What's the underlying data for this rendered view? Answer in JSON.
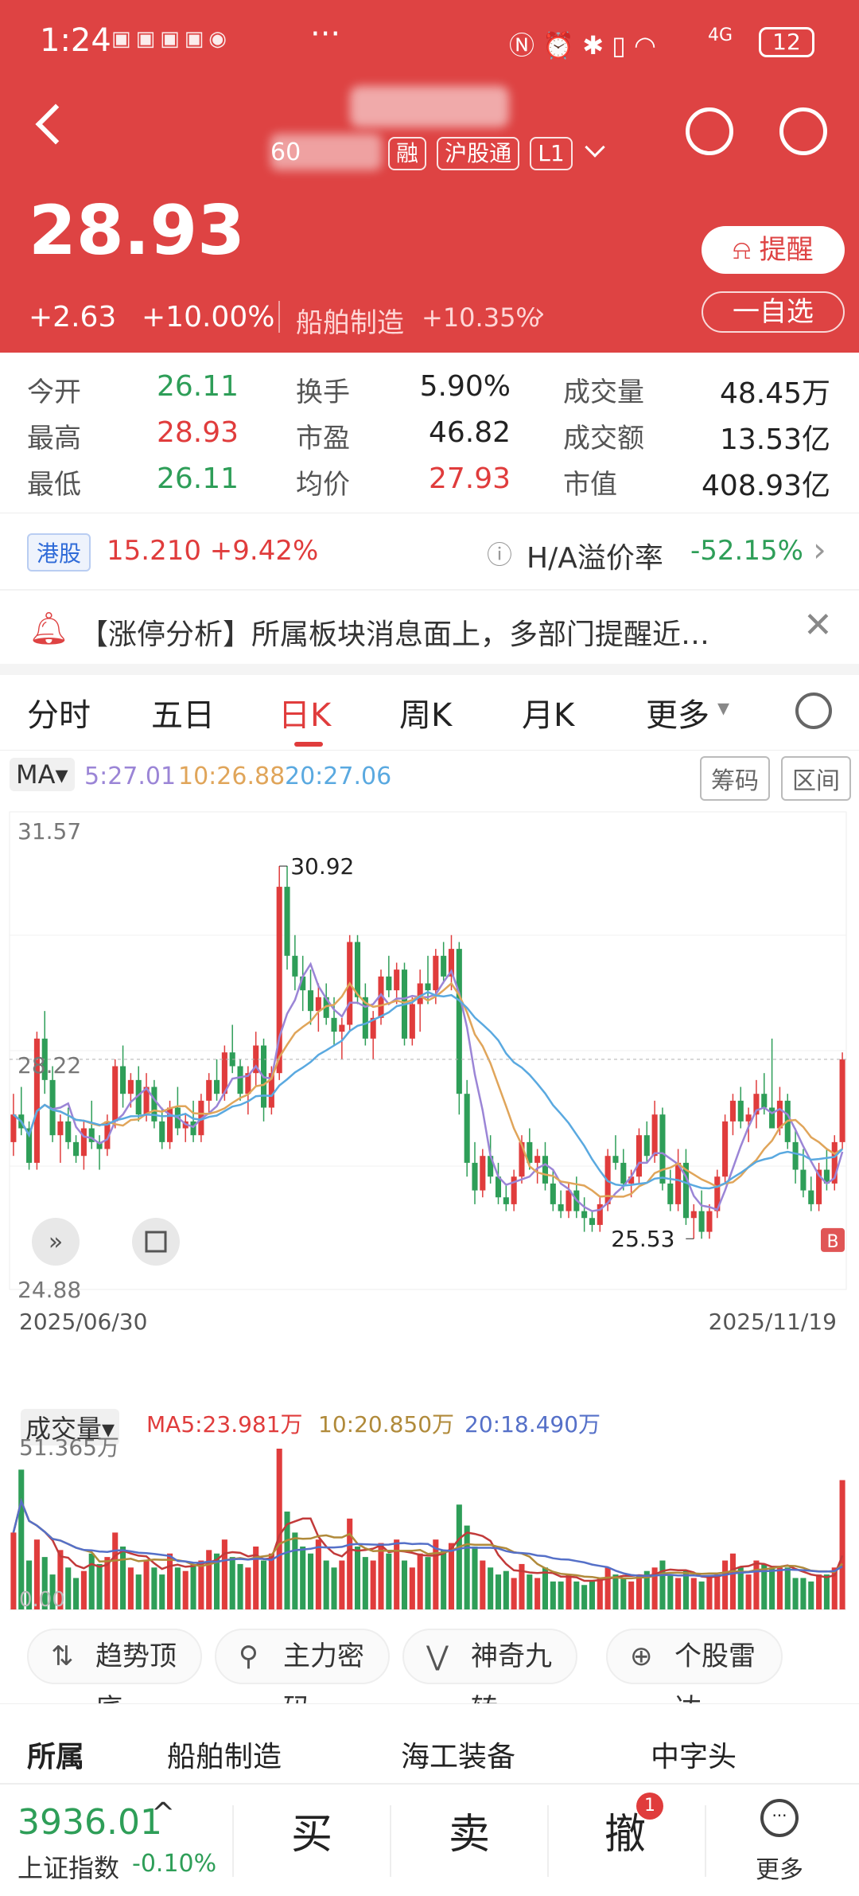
{
  "status": {
    "time": "1:24",
    "dots": "···",
    "network": "4G",
    "battery": "12"
  },
  "header": {
    "ticker_masked": "60",
    "tag_hk": "沪股通",
    "tag_level": "L1",
    "price": "28.93",
    "change": "+2.63",
    "change_pct": "+10.00%",
    "sector": "船舶制造",
    "sector_pct": "+10.35%",
    "remind": "提醒",
    "watch": "一自选"
  },
  "stats": [
    {
      "label": "今开",
      "value": "26.11",
      "tone": "green"
    },
    {
      "label": "换手",
      "value": "5.90%",
      "tone": "neutral"
    },
    {
      "label": "成交量",
      "value": "48.45万",
      "tone": "neutral"
    },
    {
      "label": "最高",
      "value": "28.93",
      "tone": "red"
    },
    {
      "label": "市盈",
      "value": "46.82",
      "tone": "neutral"
    },
    {
      "label": "成交额",
      "value": "13.53亿",
      "tone": "neutral"
    },
    {
      "label": "最低",
      "value": "26.11",
      "tone": "green"
    },
    {
      "label": "均价",
      "value": "27.93",
      "tone": "red"
    },
    {
      "label": "市值",
      "value": "408.93亿",
      "tone": "neutral"
    }
  ],
  "hk": {
    "badge": "港股",
    "quote": "15.210 +9.42%",
    "premium_label": "H/A溢价率",
    "premium_value": "-52.15%"
  },
  "news": {
    "text": "【涨停分析】所属板块消息面上，多部门提醒近…"
  },
  "tabs": [
    "分时",
    "五日",
    "日K",
    "周K",
    "月K",
    "更多"
  ],
  "ma": {
    "label": "MA",
    "ma5": "5:27.01",
    "ma10": "10:26.88",
    "ma20": "20:27.06",
    "chip1": "筹码",
    "chip2": "区间"
  },
  "chart_data": {
    "type": "candlestick",
    "ylim": [
      24.88,
      31.57
    ],
    "y_ticks": [
      "31.57",
      "28.22",
      "24.88"
    ],
    "start_date": "2025/06/30",
    "end_date": "2025/11/19",
    "annotations": {
      "high": "30.92",
      "low": "25.53"
    },
    "candles": [
      [
        26.9,
        27.6,
        26.7,
        27.3
      ],
      [
        27.3,
        27.7,
        27.0,
        27.1
      ],
      [
        27.1,
        27.2,
        26.5,
        26.6
      ],
      [
        26.6,
        28.5,
        26.5,
        28.4
      ],
      [
        28.4,
        28.8,
        27.6,
        27.8
      ],
      [
        27.8,
        28.0,
        26.9,
        27.0
      ],
      [
        27.0,
        27.3,
        26.6,
        27.2
      ],
      [
        27.2,
        27.4,
        26.8,
        26.9
      ],
      [
        26.9,
        27.0,
        26.6,
        26.7
      ],
      [
        26.7,
        27.2,
        26.5,
        27.1
      ],
      [
        27.1,
        27.5,
        26.8,
        26.9
      ],
      [
        26.9,
        27.0,
        26.5,
        26.8
      ],
      [
        26.8,
        27.3,
        26.7,
        27.2
      ],
      [
        27.2,
        28.1,
        27.1,
        28.0
      ],
      [
        28.0,
        28.3,
        27.4,
        27.6
      ],
      [
        27.6,
        27.9,
        27.4,
        27.8
      ],
      [
        27.8,
        28.0,
        27.2,
        27.3
      ],
      [
        27.3,
        27.9,
        27.2,
        27.7
      ],
      [
        27.7,
        27.8,
        27.1,
        27.2
      ],
      [
        27.2,
        27.4,
        26.8,
        26.9
      ],
      [
        26.9,
        27.5,
        26.8,
        27.4
      ],
      [
        27.4,
        27.7,
        27.0,
        27.1
      ],
      [
        27.1,
        27.3,
        26.9,
        27.2
      ],
      [
        27.2,
        27.5,
        26.9,
        27.0
      ],
      [
        27.0,
        27.6,
        26.9,
        27.5
      ],
      [
        27.5,
        27.9,
        27.3,
        27.8
      ],
      [
        27.8,
        28.1,
        27.5,
        27.6
      ],
      [
        27.6,
        28.3,
        27.5,
        28.2
      ],
      [
        28.2,
        28.6,
        27.9,
        28.0
      ],
      [
        28.0,
        28.1,
        27.5,
        27.6
      ],
      [
        27.6,
        28.0,
        27.3,
        27.9
      ],
      [
        27.9,
        28.5,
        27.7,
        28.3
      ],
      [
        28.3,
        28.4,
        27.2,
        27.4
      ],
      [
        27.4,
        28.0,
        27.3,
        27.9
      ],
      [
        27.9,
        30.9,
        27.8,
        30.6
      ],
      [
        30.6,
        30.9,
        29.4,
        29.6
      ],
      [
        29.6,
        29.9,
        29.1,
        29.3
      ],
      [
        29.3,
        29.6,
        28.8,
        29.1
      ],
      [
        29.1,
        29.4,
        28.6,
        28.8
      ],
      [
        28.8,
        29.2,
        28.5,
        29.0
      ],
      [
        29.0,
        29.2,
        28.6,
        28.7
      ],
      [
        28.7,
        29.0,
        28.3,
        28.5
      ],
      [
        28.5,
        28.7,
        28.1,
        28.6
      ],
      [
        28.6,
        29.9,
        28.5,
        29.8
      ],
      [
        29.8,
        29.9,
        28.9,
        29.0
      ],
      [
        29.0,
        29.2,
        28.3,
        28.4
      ],
      [
        28.4,
        28.8,
        28.1,
        28.7
      ],
      [
        28.7,
        29.4,
        28.6,
        29.3
      ],
      [
        29.3,
        29.6,
        29.0,
        29.1
      ],
      [
        29.1,
        29.5,
        28.9,
        29.4
      ],
      [
        29.4,
        29.5,
        28.3,
        28.4
      ],
      [
        28.4,
        29.0,
        28.3,
        28.9
      ],
      [
        28.9,
        29.4,
        28.5,
        29.2
      ],
      [
        29.2,
        29.6,
        28.9,
        29.1
      ],
      [
        29.1,
        29.7,
        28.9,
        29.6
      ],
      [
        29.6,
        29.8,
        29.2,
        29.3
      ],
      [
        29.3,
        29.9,
        29.1,
        29.7
      ],
      [
        29.7,
        29.8,
        27.3,
        27.6
      ],
      [
        27.6,
        27.8,
        26.4,
        26.6
      ],
      [
        26.6,
        26.9,
        26.0,
        26.2
      ],
      [
        26.2,
        26.8,
        26.1,
        26.7
      ],
      [
        26.7,
        27.0,
        26.3,
        26.4
      ],
      [
        26.4,
        26.6,
        26.0,
        26.1
      ],
      [
        26.1,
        26.3,
        25.9,
        26.0
      ],
      [
        26.0,
        26.5,
        25.9,
        26.4
      ],
      [
        26.4,
        27.0,
        26.3,
        26.9
      ],
      [
        26.9,
        27.1,
        26.5,
        26.6
      ],
      [
        26.6,
        26.8,
        26.3,
        26.7
      ],
      [
        26.7,
        26.9,
        26.2,
        26.3
      ],
      [
        26.3,
        26.5,
        25.9,
        26.0
      ],
      [
        26.0,
        26.2,
        25.8,
        25.9
      ],
      [
        25.9,
        26.3,
        25.8,
        26.2
      ],
      [
        26.2,
        26.4,
        25.8,
        25.9
      ],
      [
        25.9,
        26.1,
        25.6,
        25.8
      ],
      [
        25.8,
        25.9,
        25.6,
        25.7
      ],
      [
        25.7,
        26.1,
        25.6,
        26.0
      ],
      [
        26.0,
        26.8,
        25.9,
        26.7
      ],
      [
        26.7,
        27.0,
        26.5,
        26.6
      ],
      [
        26.6,
        26.8,
        26.2,
        26.3
      ],
      [
        26.3,
        26.5,
        26.1,
        26.4
      ],
      [
        26.4,
        27.1,
        26.3,
        27.0
      ],
      [
        27.0,
        27.2,
        26.6,
        26.7
      ],
      [
        26.7,
        27.5,
        26.6,
        27.3
      ],
      [
        27.3,
        27.4,
        26.2,
        26.3
      ],
      [
        26.3,
        26.5,
        25.9,
        26.0
      ],
      [
        26.0,
        26.8,
        25.9,
        26.6
      ],
      [
        26.6,
        26.8,
        25.7,
        25.8
      ],
      [
        25.8,
        26.0,
        25.5,
        25.9
      ],
      [
        25.9,
        26.2,
        25.5,
        25.6
      ],
      [
        25.6,
        26.0,
        25.5,
        25.9
      ],
      [
        25.9,
        26.5,
        25.8,
        26.4
      ],
      [
        26.4,
        27.3,
        26.3,
        27.2
      ],
      [
        27.2,
        27.6,
        27.0,
        27.5
      ],
      [
        27.5,
        27.7,
        27.1,
        27.2
      ],
      [
        27.2,
        27.4,
        26.9,
        27.3
      ],
      [
        27.3,
        27.8,
        27.1,
        27.6
      ],
      [
        27.6,
        27.9,
        27.3,
        27.4
      ],
      [
        27.4,
        28.4,
        27.2,
        27.1
      ],
      [
        27.1,
        27.7,
        27.0,
        27.5
      ],
      [
        27.5,
        27.6,
        26.8,
        26.9
      ],
      [
        26.9,
        27.1,
        26.3,
        26.5
      ],
      [
        26.5,
        26.8,
        26.1,
        26.2
      ],
      [
        26.2,
        26.4,
        25.9,
        26.0
      ],
      [
        26.0,
        26.6,
        25.9,
        26.5
      ],
      [
        26.5,
        26.8,
        26.2,
        26.3
      ],
      [
        26.3,
        27.0,
        26.2,
        26.9
      ],
      [
        26.9,
        28.2,
        26.8,
        28.1
      ]
    ],
    "volume": {
      "label": "成交量",
      "max_label": "51.365万",
      "zero_label": "0.00",
      "ma5": "MA5:23.981万",
      "ma10": "10:20.850万",
      "ma20": "20:18.490万",
      "values": [
        22,
        40,
        14,
        20,
        15,
        10,
        17,
        12,
        9,
        11,
        16,
        13,
        15,
        22,
        18,
        12,
        10,
        14,
        12,
        10,
        16,
        12,
        11,
        13,
        14,
        17,
        16,
        20,
        15,
        13,
        12,
        18,
        14,
        16,
        46,
        28,
        22,
        18,
        16,
        20,
        14,
        12,
        14,
        26,
        18,
        15,
        14,
        19,
        16,
        20,
        14,
        12,
        16,
        15,
        20,
        17,
        19,
        30,
        24,
        18,
        14,
        12,
        10,
        11,
        9,
        13,
        10,
        9,
        12,
        8,
        8,
        10,
        8,
        7,
        8,
        9,
        12,
        10,
        9,
        8,
        10,
        11,
        12,
        14,
        10,
        9,
        11,
        9,
        8,
        9,
        10,
        14,
        16,
        12,
        10,
        14,
        13,
        12,
        12,
        12,
        9,
        9,
        8,
        10,
        10,
        12,
        37
      ]
    }
  },
  "tools": [
    "趋势顶底",
    "主力密码",
    "神奇九转",
    "个股雷达"
  ],
  "related": [
    "所属",
    "船舶制造",
    "海工装备",
    "中字头"
  ],
  "bottom": {
    "index_value": "3936.01",
    "index_name": "上证指数",
    "index_change": "-0.10%",
    "buy": "买",
    "sell": "卖",
    "cancel": "撤",
    "cancel_badge": "1",
    "more": "更多"
  },
  "colors": {
    "up": "#e03c3c",
    "down": "#2e9e58",
    "ma5": "#9b85d6",
    "ma10": "#e0a55a",
    "ma20": "#5aa9e0"
  }
}
